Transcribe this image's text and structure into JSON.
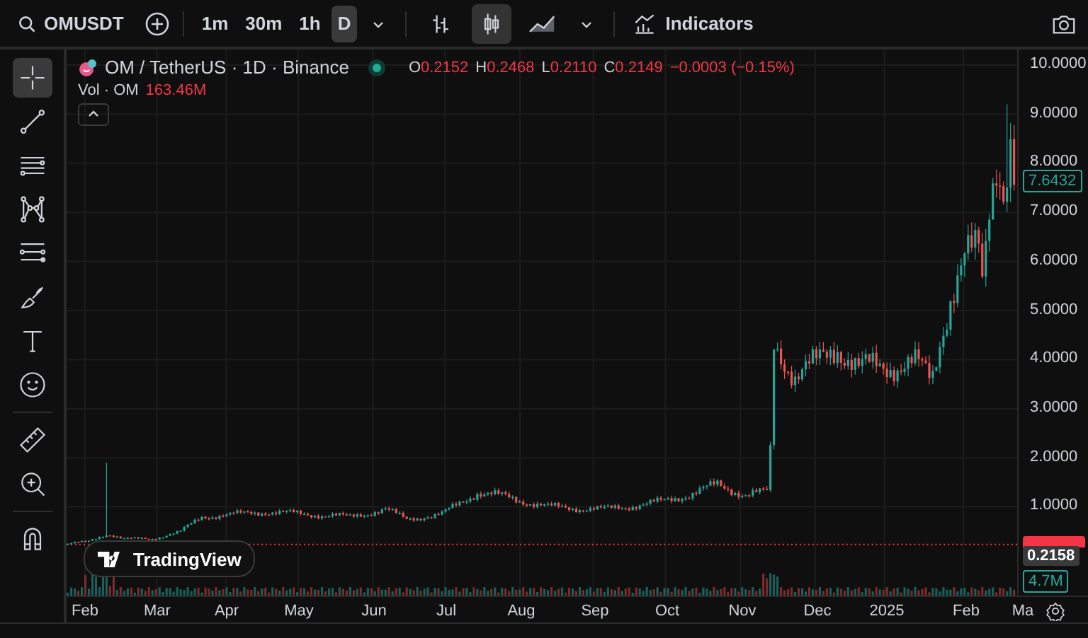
{
  "toolbar": {
    "symbol": "OMUSDT",
    "intervals": [
      {
        "label": "1m",
        "selected": false
      },
      {
        "label": "30m",
        "selected": false
      },
      {
        "label": "1h",
        "selected": false
      },
      {
        "label": "D",
        "selected": true
      }
    ],
    "chart_types": [
      {
        "kind": "bars",
        "selected": false
      },
      {
        "kind": "candles",
        "selected": true
      },
      {
        "kind": "area",
        "selected": false
      }
    ],
    "indicators": "Indicators"
  },
  "drawing_tools": [
    {
      "kind": "crosshair",
      "selected": true
    },
    {
      "kind": "trend-line",
      "selected": false
    },
    {
      "kind": "fib",
      "selected": false
    },
    {
      "kind": "pattern",
      "selected": false
    },
    {
      "kind": "projection",
      "selected": false
    },
    {
      "kind": "brush",
      "selected": false
    },
    {
      "kind": "text",
      "selected": false
    },
    {
      "kind": "emoji",
      "selected": false
    },
    {
      "kind": "ruler",
      "selected": false
    },
    {
      "kind": "zoom",
      "selected": false
    },
    {
      "kind": "magnet",
      "selected": false
    }
  ],
  "legend": {
    "title": "OM / TetherUS · 1D · Binance",
    "ohlc": [
      {
        "label": "O",
        "value": "0.2152"
      },
      {
        "label": "H",
        "value": "0.2468"
      },
      {
        "label": "L",
        "value": "0.2110"
      },
      {
        "label": "C",
        "value": "0.2149"
      }
    ],
    "change": "−0.0003 (−0.15%)",
    "volume_label": "Vol · OM",
    "volume": "163.46M"
  },
  "price_axis": {
    "ticks": [
      "10.0000",
      "9.0000",
      "8.0000",
      "7.0000",
      "6.0000",
      "5.0000",
      "4.0000",
      "3.0000",
      "2.0000",
      "1.0000"
    ],
    "last_price": "7.6432",
    "crosshair_price": "0.2158",
    "volume_tag": "4.7M"
  },
  "time_axis": [
    "Feb",
    "Mar",
    "Apr",
    "May",
    "Jun",
    "Jul",
    "Aug",
    "Sep",
    "Oct",
    "Nov",
    "Dec",
    "2025",
    "Feb",
    "Ma"
  ],
  "logo": "TradingView"
}
